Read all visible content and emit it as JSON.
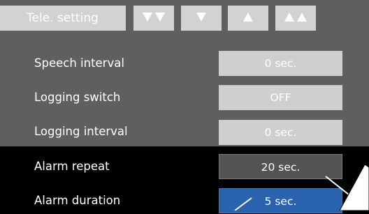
{
  "header": {
    "title": "Tele. setting",
    "buttons": [
      {
        "name": "page-down-button",
        "icon": "double-down-triangle-icon"
      },
      {
        "name": "down-button",
        "icon": "down-triangle-icon"
      },
      {
        "name": "up-button",
        "icon": "up-triangle-icon"
      },
      {
        "name": "page-up-button",
        "icon": "double-up-triangle-icon"
      }
    ]
  },
  "settings": [
    {
      "label": "Speech interval",
      "value": "0 sec."
    },
    {
      "label": "Logging switch",
      "value": "OFF"
    },
    {
      "label": "Logging interval",
      "value": "0 sec."
    },
    {
      "label": "Alarm repeat",
      "value": "20 sec."
    },
    {
      "label": "Alarm duration",
      "value": "5 sec."
    }
  ],
  "colors": {
    "panel_gray": "#5f5f5f",
    "value_light": "#cfcfcf",
    "value_selected_dark": "#545454",
    "value_active_blue": "#2a63ad"
  }
}
